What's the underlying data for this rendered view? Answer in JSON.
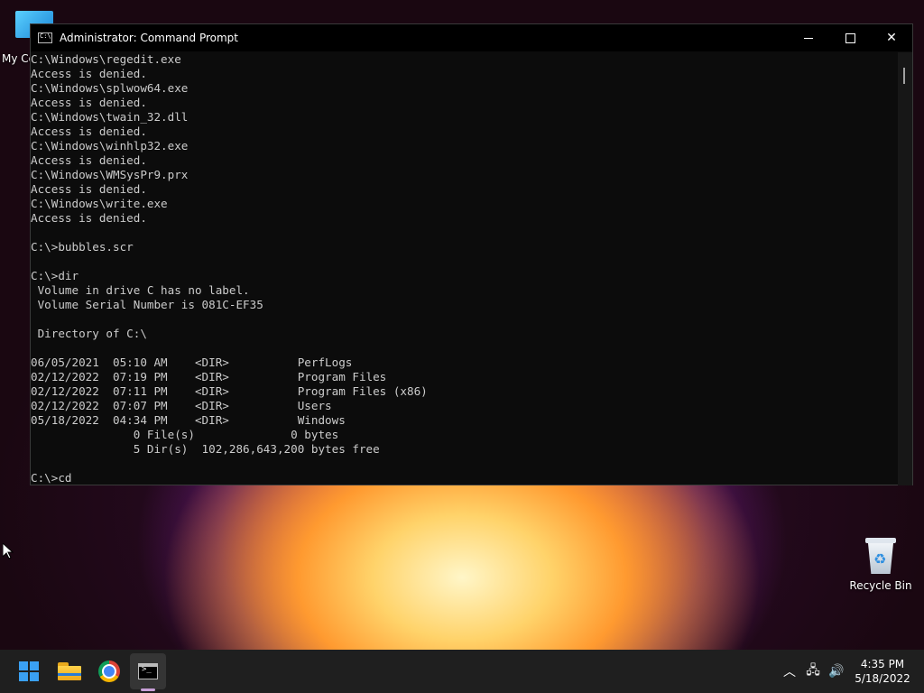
{
  "desktop": {
    "my_computer_label": "My Co",
    "recycle_bin_label": "Recycle Bin"
  },
  "window": {
    "title": "Administrator: Command Prompt",
    "minimize": "",
    "maximize": "",
    "close": "✕"
  },
  "console": {
    "lines": [
      "C:\\Windows\\regedit.exe",
      "Access is denied.",
      "C:\\Windows\\splwow64.exe",
      "Access is denied.",
      "C:\\Windows\\twain_32.dll",
      "Access is denied.",
      "C:\\Windows\\winhlp32.exe",
      "Access is denied.",
      "C:\\Windows\\WMSysPr9.prx",
      "Access is denied.",
      "C:\\Windows\\write.exe",
      "Access is denied.",
      "",
      "C:\\>bubbles.scr",
      "",
      "C:\\>dir",
      " Volume in drive C has no label.",
      " Volume Serial Number is 081C-EF35",
      "",
      " Directory of C:\\",
      "",
      "06/05/2021  05:10 AM    <DIR>          PerfLogs",
      "02/12/2022  07:19 PM    <DIR>          Program Files",
      "02/12/2022  07:11 PM    <DIR>          Program Files (x86)",
      "02/12/2022  07:07 PM    <DIR>          Users",
      "05/18/2022  04:34 PM    <DIR>          Windows",
      "               0 File(s)              0 bytes",
      "               5 Dir(s)  102,286,643,200 bytes free",
      "",
      "C:\\>cd"
    ]
  },
  "taskbar": {
    "apps": [
      {
        "name": "start-button"
      },
      {
        "name": "file-explorer-icon"
      },
      {
        "name": "chrome-icon"
      },
      {
        "name": "command-prompt-icon"
      }
    ],
    "tray": {
      "chevron": "︿",
      "network": "🖧",
      "volume": "🔊"
    },
    "clock": {
      "time": "4:35 PM",
      "date": "5/18/2022"
    }
  }
}
